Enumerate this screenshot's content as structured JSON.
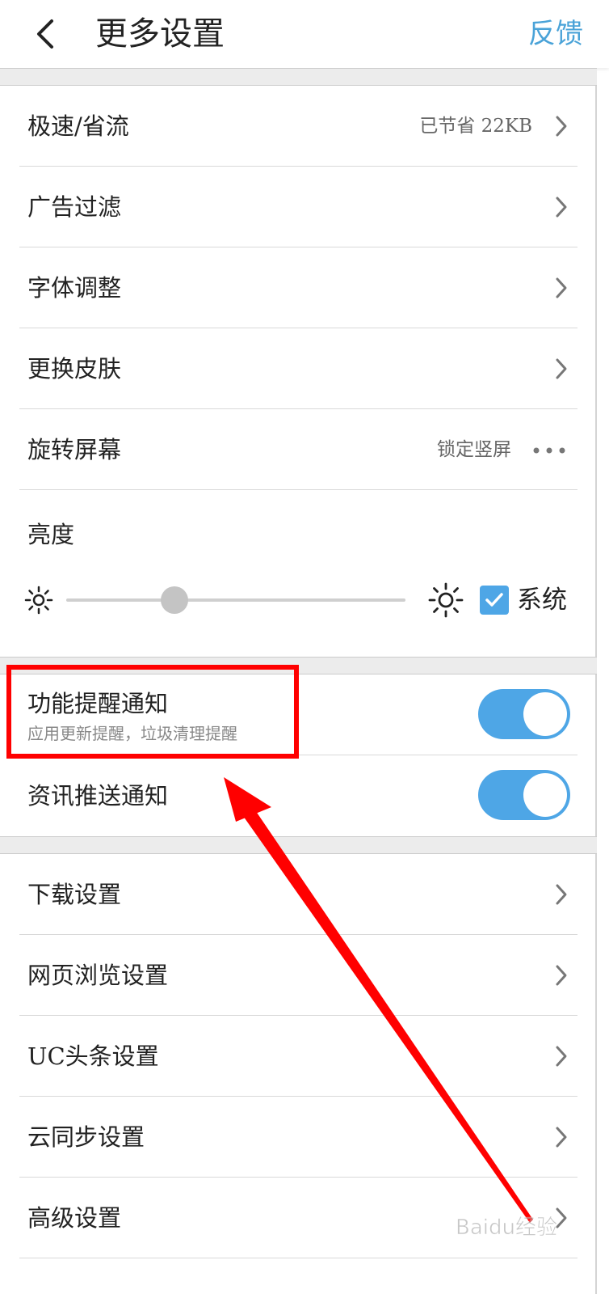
{
  "header": {
    "title": "更多设置",
    "feedback_label": "反馈"
  },
  "settings": {
    "speed_saver": {
      "label": "极速/省流",
      "value": "已节省  22KB"
    },
    "ad_filter": {
      "label": "广告过滤"
    },
    "font_adjust": {
      "label": "字体调整"
    },
    "skin": {
      "label": "更换皮肤"
    },
    "rotate_screen": {
      "label": "旋转屏幕",
      "value": "锁定竖屏"
    }
  },
  "brightness": {
    "label": "亮度",
    "level": 0.32,
    "system_label": "系统",
    "system_checked": true
  },
  "notifications": {
    "feature": {
      "title": "功能提醒通知",
      "subtitle": "应用更新提醒，垃圾清理提醒",
      "enabled": true
    },
    "news": {
      "title": "资讯推送通知",
      "enabled": true
    }
  },
  "more": {
    "download": {
      "label": "下载设置"
    },
    "browse": {
      "label": "网页浏览设置"
    },
    "uc_headline": {
      "label": "UC头条设置"
    },
    "cloud_sync": {
      "label": "云同步设置"
    },
    "advanced": {
      "label": "高级设置"
    }
  },
  "watermark": {
    "text": "Baidu经验"
  },
  "colors": {
    "accent": "#4ea6e6",
    "link": "#4aa3d8",
    "toggle_on": "#4ea6e6",
    "annotation_red": "#ff0000"
  },
  "icons": {
    "back": "chevron-left-icon",
    "row_more": "chevron-right-icon",
    "rotate_more": "more-dots-icon",
    "brightness_low": "sun-small-icon",
    "brightness_high": "sun-large-icon",
    "system_check": "checkmark-icon"
  }
}
